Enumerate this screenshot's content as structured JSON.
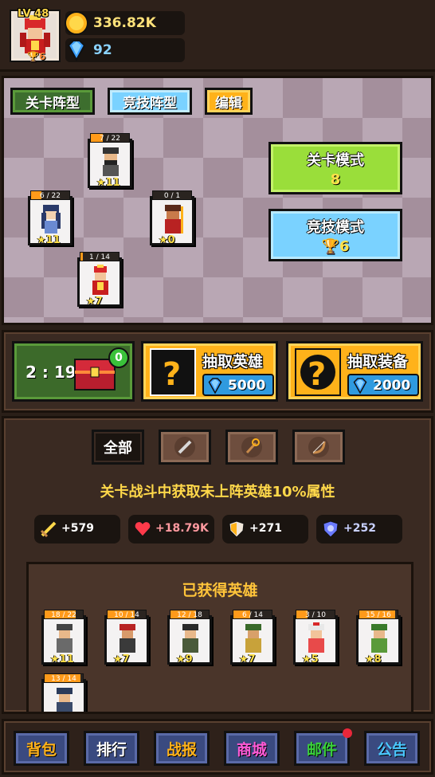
{
  "player": {
    "level": "LV 48",
    "cups": "6"
  },
  "resources": {
    "gold": "336.82K",
    "gems": "92"
  },
  "formation": {
    "tabs": [
      "关卡阵型",
      "竞技阵型",
      "编辑"
    ],
    "stage_mode": {
      "title": "关卡模式",
      "value": "8"
    },
    "arena_mode": {
      "title": "竞技模式",
      "value": "6"
    },
    "heroes": [
      {
        "frag": "7 / 22",
        "stars": "11",
        "progress": 0.32
      },
      {
        "frag": "6 / 22",
        "stars": "11",
        "progress": 0.27
      },
      {
        "frag": "0 / 1",
        "stars": "0",
        "progress": 0.0
      },
      {
        "frag": "1 / 14",
        "stars": "7",
        "progress": 0.07
      }
    ]
  },
  "shop": {
    "timer": "2 : 19",
    "chest_badge": "0",
    "draw_hero": {
      "label": "抽取英雄",
      "cost": "5000"
    },
    "draw_equip": {
      "label": "抽取装备",
      "cost": "2000"
    }
  },
  "hero_panel": {
    "filter_all": "全部",
    "bonus_text": "关卡战斗中获取未上阵英雄10%属性",
    "stats": {
      "attack": "+579",
      "hp": "+18.79K",
      "defense": "+271",
      "magic": "+252"
    },
    "owned_title": "已获得英雄",
    "owned": [
      {
        "frag": "18 / 22",
        "stars": "11",
        "progress": 0.82
      },
      {
        "frag": "10 / 14",
        "stars": "7",
        "progress": 0.71
      },
      {
        "frag": "12 / 18",
        "stars": "9",
        "progress": 0.67
      },
      {
        "frag": "6 / 14",
        "stars": "7",
        "progress": 0.43
      },
      {
        "frag": "3 / 10",
        "stars": "5",
        "progress": 0.3
      },
      {
        "frag": "15 / 16",
        "stars": "8",
        "progress": 0.94
      },
      {
        "frag": "13 / 14",
        "stars": "",
        "progress": 0.93
      }
    ]
  },
  "nav": {
    "items": [
      {
        "label": "背包",
        "color": "#ffb21a"
      },
      {
        "label": "排行",
        "color": "#ffffff"
      },
      {
        "label": "战报",
        "color": "#ffb21a"
      },
      {
        "label": "商城",
        "color": "#ff5ad6"
      },
      {
        "label": "邮件",
        "color": "#3ad23a"
      },
      {
        "label": "公告",
        "color": "#4ac8ff"
      }
    ]
  }
}
